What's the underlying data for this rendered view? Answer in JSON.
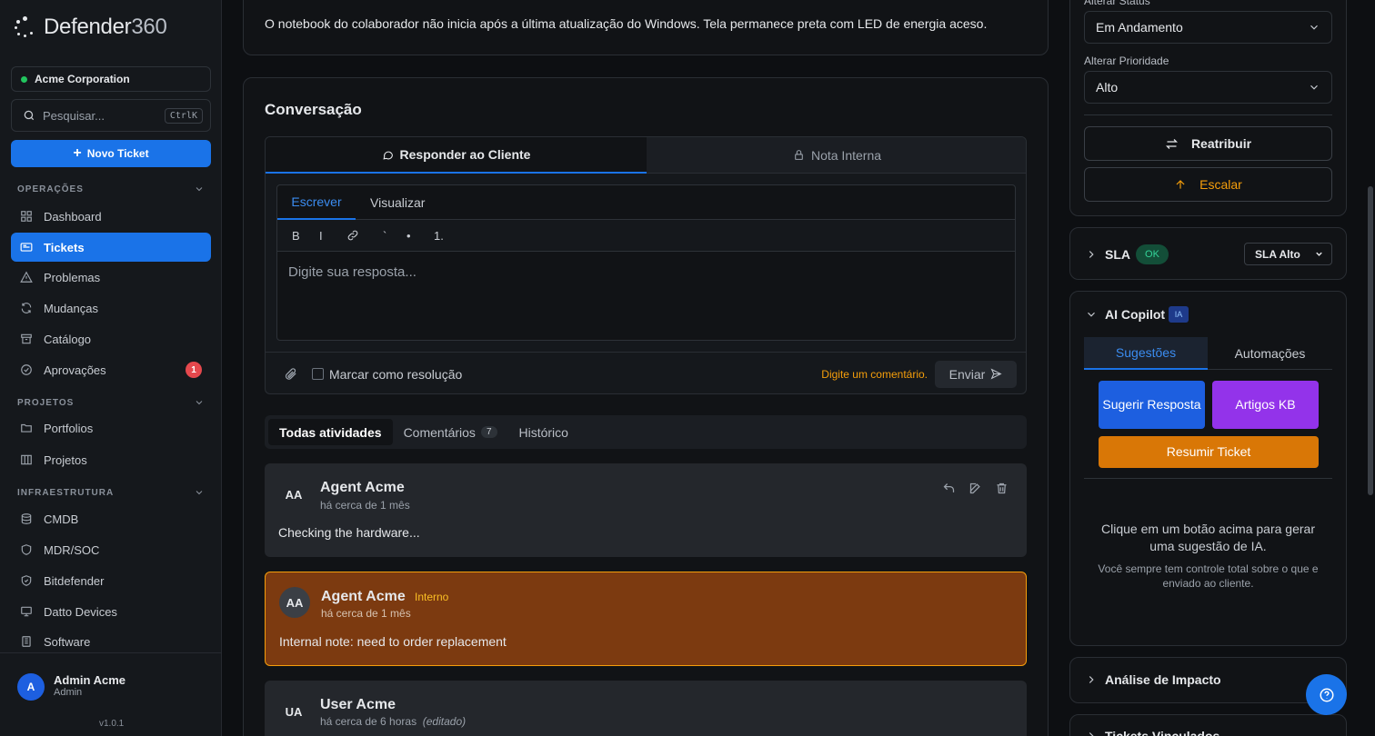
{
  "brand": {
    "name": "Defender",
    "number": "360"
  },
  "sidebar": {
    "org": "Acme Corporation",
    "search_placeholder": "Pesquisar...",
    "search_shortcut": "CtrlK",
    "new_ticket": "Novo Ticket",
    "sections": [
      {
        "title": "OPERAÇÕES",
        "items": [
          {
            "label": "Dashboard",
            "icon": "grid-icon"
          },
          {
            "label": "Tickets",
            "icon": "ticket-icon",
            "active": true
          },
          {
            "label": "Problemas",
            "icon": "warning-icon"
          },
          {
            "label": "Mudanças",
            "icon": "refresh-icon"
          },
          {
            "label": "Catálogo",
            "icon": "archive-icon"
          },
          {
            "label": "Aprovações",
            "icon": "check-circle-icon",
            "badge": "1"
          }
        ]
      },
      {
        "title": "PROJETOS",
        "items": [
          {
            "label": "Portfolios",
            "icon": "folder-icon"
          },
          {
            "label": "Projetos",
            "icon": "columns-icon"
          }
        ]
      },
      {
        "title": "INFRAESTRUTURA",
        "items": [
          {
            "label": "CMDB",
            "icon": "database-icon"
          },
          {
            "label": "MDR/SOC",
            "icon": "shield-icon"
          },
          {
            "label": "Bitdefender",
            "icon": "shield-check-icon"
          },
          {
            "label": "Datto Devices",
            "icon": "monitor-icon"
          },
          {
            "label": "Software",
            "icon": "package-icon"
          }
        ]
      }
    ],
    "user": {
      "initial": "A",
      "name": "Admin Acme",
      "role": "Admin"
    },
    "version": "v1.0.1"
  },
  "ticket": {
    "description": "O notebook do colaborador não inicia após a última atualização do Windows. Tela permanece preta com LED de energia aceso."
  },
  "conversation": {
    "title": "Conversação",
    "tab_reply": "Responder ao Cliente",
    "tab_note": "Nota Interna",
    "editor_tab_write": "Escrever",
    "editor_tab_preview": "Visualizar",
    "toolbar": [
      "B",
      "I",
      "link",
      "`",
      "•",
      "1."
    ],
    "placeholder": "Digite sua resposta...",
    "mark_resolution": "Marcar como resolução",
    "warning": "Digite um comentário.",
    "send": "Enviar"
  },
  "activity": {
    "tabs": {
      "all": "Todas atividades",
      "comments": "Comentários",
      "comments_count": "7",
      "history": "Histórico"
    },
    "items": [
      {
        "initials": "AA",
        "author": "Agent Acme",
        "time": "há cerca de 1 mês",
        "body": "Checking the hardware..."
      },
      {
        "initials": "AA",
        "author": "Agent Acme",
        "tag": "Interno",
        "time": "há cerca de 1 mês",
        "body": "Internal note: need to order replacement"
      },
      {
        "initials": "UA",
        "author": "User Acme",
        "time": "há cerca de 6 horas",
        "edited": "(editado)"
      }
    ]
  },
  "right": {
    "status_label": "Alterar Status",
    "status_value": "Em Andamento",
    "priority_label": "Alterar Prioridade",
    "priority_value": "Alto",
    "reassign": "Reatribuir",
    "escalate": "Escalar",
    "sla": {
      "title": "SLA",
      "status": "OK",
      "policy": "SLA Alto"
    },
    "copilot": {
      "title": "AI Copilot",
      "badge": "IA",
      "tab_suggestions": "Sugestões",
      "tab_automations": "Automações",
      "btn_suggest": "Sugerir Resposta",
      "btn_kb": "Artigos KB",
      "btn_summary": "Resumir Ticket",
      "hint": "Clique em um botão acima para gerar uma sugestão de IA.",
      "subhint": "Você sempre tem controle total sobre o que e enviado ao cliente."
    },
    "impact": "Análise de Impacto",
    "linked": "Tickets Vinculados"
  },
  "colors": {
    "accent": "#1a73e8",
    "internal_note_bg": "#7c3a10",
    "internal_note_border": "#f59e0b",
    "escalate": "#f59e0b",
    "kb": "#9333ea",
    "summary": "#d97706"
  }
}
